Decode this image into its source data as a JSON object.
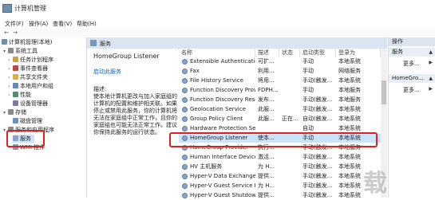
{
  "window": {
    "title": "计算机管理"
  },
  "menu": [
    "文件(F)",
    "操作(A)",
    "查看(V)",
    "帮助(H)"
  ],
  "tree": {
    "items": [
      {
        "label": "计算机管理(本地)",
        "arrow": "",
        "color": "#6f8fb0"
      },
      {
        "label": "系统工具",
        "arrow": "▾",
        "color": "#8a8a8a"
      },
      {
        "label": "任务计划程序",
        "arrow": "›",
        "color": "#c9a24b"
      },
      {
        "label": "事件查看器",
        "arrow": "›",
        "color": "#b54b4b"
      },
      {
        "label": "共享文件夹",
        "arrow": "›",
        "color": "#d8b04a"
      },
      {
        "label": "本地用户和组",
        "arrow": "›",
        "color": "#6b87b4"
      },
      {
        "label": "性能",
        "arrow": "›",
        "color": "#4b8f6b"
      },
      {
        "label": "设备管理器",
        "arrow": "",
        "color": "#7b7b9e"
      },
      {
        "label": "存储",
        "arrow": "▾",
        "color": "#8a8a8a"
      },
      {
        "label": "磁盘管理",
        "arrow": "",
        "color": "#7090c0"
      },
      {
        "label": "服务和应用程序",
        "arrow": "▾",
        "color": "#8a8a8a"
      },
      {
        "label": "服务",
        "arrow": "",
        "color": "#8da4c0"
      },
      {
        "label": "WMI 控件",
        "arrow": "",
        "color": "#7a9ab8"
      }
    ]
  },
  "services_header": "服务",
  "detail": {
    "title": "HomeGroup Listener",
    "link": "启动此服务",
    "desc_label": "描述:",
    "desc_text": "使本地计算机更改与加入家庭组的计算机的配置和维护相关联。如果停止或禁用此服务，你的计算机将无法在家庭组中正常工作，且你的家庭组也可能无法正常工作。建议你保持此服务的运行状态。"
  },
  "columns": [
    "名称",
    "描述",
    "状态",
    "启动类型",
    "登录为"
  ],
  "rows": [
    {
      "name": "Extensible Authentication...",
      "desc": "可扩...",
      "status": "",
      "startup": "手动",
      "logon": "本地系统"
    },
    {
      "name": "Fax",
      "desc": "利用...",
      "status": "",
      "startup": "手动",
      "logon": "网络服务"
    },
    {
      "name": "File History Service",
      "desc": "将用...",
      "status": "",
      "startup": "手动(触发...",
      "logon": "本地系统"
    },
    {
      "name": "Function Discovery Provi...",
      "desc": "FDPH...",
      "status": "",
      "startup": "手动",
      "logon": "本地服务"
    },
    {
      "name": "Function Discovery Reso...",
      "desc": "发布...",
      "status": "",
      "startup": "手动(触发...",
      "logon": "本地服务"
    },
    {
      "name": "Geolocation Service",
      "desc": "此服...",
      "status": "",
      "startup": "手动(触发...",
      "logon": "本地系统"
    },
    {
      "name": "Group Policy Client",
      "desc": "此服...",
      "status": "正在...",
      "startup": "自动(触发...",
      "logon": "本地系统"
    },
    {
      "name": "Hardware Protection Ser...",
      "desc": "",
      "status": "",
      "startup": "自动",
      "logon": "本地系统"
    },
    {
      "name": "HomeGroup Listener",
      "desc": "使本...",
      "status": "",
      "startup": "手动",
      "logon": "本地系统"
    },
    {
      "name": "HomeGroup Provider",
      "desc": "执行...",
      "status": "",
      "startup": "手动(触发...",
      "logon": "本地服务"
    },
    {
      "name": "Human Interface Device ...",
      "desc": "激活...",
      "status": "",
      "startup": "手动(触发...",
      "logon": "本地系统"
    },
    {
      "name": "HV 主机服务",
      "desc": "为 H...",
      "status": "",
      "startup": "手动(触发...",
      "logon": "本地系统"
    },
    {
      "name": "Hyper-V Data Exchange ...",
      "desc": "提供...",
      "status": "",
      "startup": "手动(触发...",
      "logon": "本地系统"
    },
    {
      "name": "Hyper-V Guest Service In...",
      "desc": "为 H...",
      "status": "",
      "startup": "手动(触发...",
      "logon": "本地系统"
    },
    {
      "name": "Hyper-V Guest Shutdown...",
      "desc": "提供...",
      "status": "",
      "startup": "手动(触发...",
      "logon": "本地系统"
    }
  ],
  "actions": {
    "header": "操作",
    "groups": [
      {
        "title": "服务",
        "more": "更多..."
      },
      {
        "title": "HomeGro...",
        "more": "更多..."
      }
    ]
  },
  "watermark": "载"
}
